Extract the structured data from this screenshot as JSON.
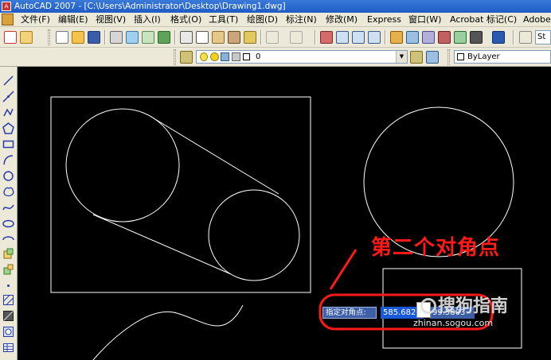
{
  "window": {
    "title": "AutoCAD 2007 - [C:\\Users\\Administrator\\Desktop\\Drawing1.dwg]"
  },
  "menu": {
    "items": [
      {
        "label": "文件(F)"
      },
      {
        "label": "编辑(E)"
      },
      {
        "label": "视图(V)"
      },
      {
        "label": "插入(I)"
      },
      {
        "label": "格式(O)"
      },
      {
        "label": "工具(T)"
      },
      {
        "label": "绘图(D)"
      },
      {
        "label": "标注(N)"
      },
      {
        "label": "修改(M)"
      },
      {
        "label": "Express"
      },
      {
        "label": "窗口(W)"
      },
      {
        "label": "Acrobat 标记(C)"
      },
      {
        "label": "Adobe"
      }
    ]
  },
  "toolbar": {
    "style_combo_value": "St",
    "layer_combo_value": "0",
    "color_combo_value": "ByLayer"
  },
  "dynamic_input": {
    "prompt": "指定对角点:",
    "x_value": "585.682",
    "y_value": "99.5803"
  },
  "annotation": {
    "text": "第二个对角点",
    "color": "#ff1a1a"
  },
  "watermark": {
    "text": "搜狗指南",
    "url": "zhinan.sogou.com"
  },
  "colors": {
    "canvas_bg": "#000000",
    "geometry": "#ffffff",
    "highlight": "#ff1a1a",
    "input_bg": "#1b5ad6"
  }
}
